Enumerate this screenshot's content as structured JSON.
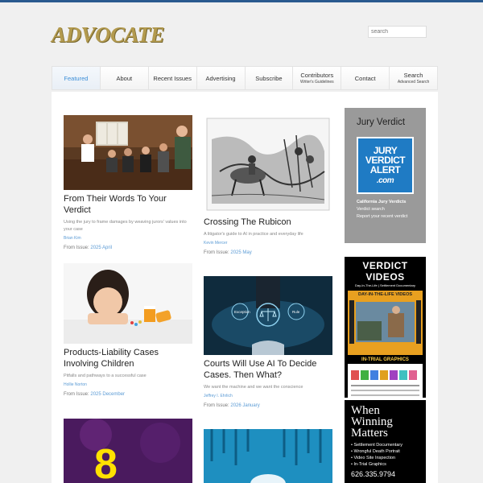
{
  "header": {
    "logo": "ADVOCATE",
    "search_placeholder": "search"
  },
  "nav": [
    {
      "label": "Featured",
      "sub": ""
    },
    {
      "label": "About",
      "sub": ""
    },
    {
      "label": "Recent Issues",
      "sub": ""
    },
    {
      "label": "Advertising",
      "sub": ""
    },
    {
      "label": "Subscribe",
      "sub": ""
    },
    {
      "label": "Contributors",
      "sub": "Writer's Guidelines"
    },
    {
      "label": "Contact",
      "sub": ""
    },
    {
      "label": "Search",
      "sub": "Advanced Search"
    }
  ],
  "articles": [
    {
      "title": "From Their Words To Your Verdict",
      "subtitle": "Using the jury to frame damages by weaving jurors' values into your case",
      "author": "Brian Kim",
      "issue_label": "From Issue:",
      "issue": "2025 April"
    },
    {
      "title": "Crossing The Rubicon",
      "subtitle": "A litigator's guide to AI in practice and everyday life",
      "author": "Kevin Mercer",
      "issue_label": "From Issue:",
      "issue": "2025 May"
    },
    {
      "title": "Products-Liability Cases Involving Children",
      "subtitle": "Pitfalls and pathways to a successful case",
      "author": "Hollie Norton",
      "issue_label": "From Issue:",
      "issue": "2025 December"
    },
    {
      "title": "Courts Will Use AI To Decide Cases. Then What?",
      "subtitle": "We want the machine and we want the conscience",
      "author": "Jeffrey I. Ehrlich",
      "issue_label": "From Issue:",
      "issue": "2026 January"
    }
  ],
  "sidebar": {
    "jury_verdict": {
      "heading": "Jury Verdict",
      "logo_lines": [
        "JURY",
        "VERDICT",
        "ALERT",
        ".com"
      ],
      "links": [
        "California Jury Verdicts",
        "Verdict search",
        "Report your recent verdict"
      ]
    },
    "verdict_videos": {
      "title": "VERDICT VIDEOS",
      "subtitle": "Day-In-The-Life | Settlement Documentary",
      "band": "DAY-IN-THE-LIFE VIDEOS",
      "trial": "IN-TRIAL GRAPHICS"
    },
    "winning": {
      "head": "When Winning Matters",
      "items": [
        "• Settlement Documentary",
        "• Wrongful Death Portrait",
        "• Video Site Inspection",
        "• In-Trial Graphics"
      ],
      "phone": "626.335.9794"
    }
  },
  "colors": {
    "accent": "#3d8fd8",
    "logo_gold": "#b39a4e",
    "jury_blue": "#1f7bc4"
  }
}
